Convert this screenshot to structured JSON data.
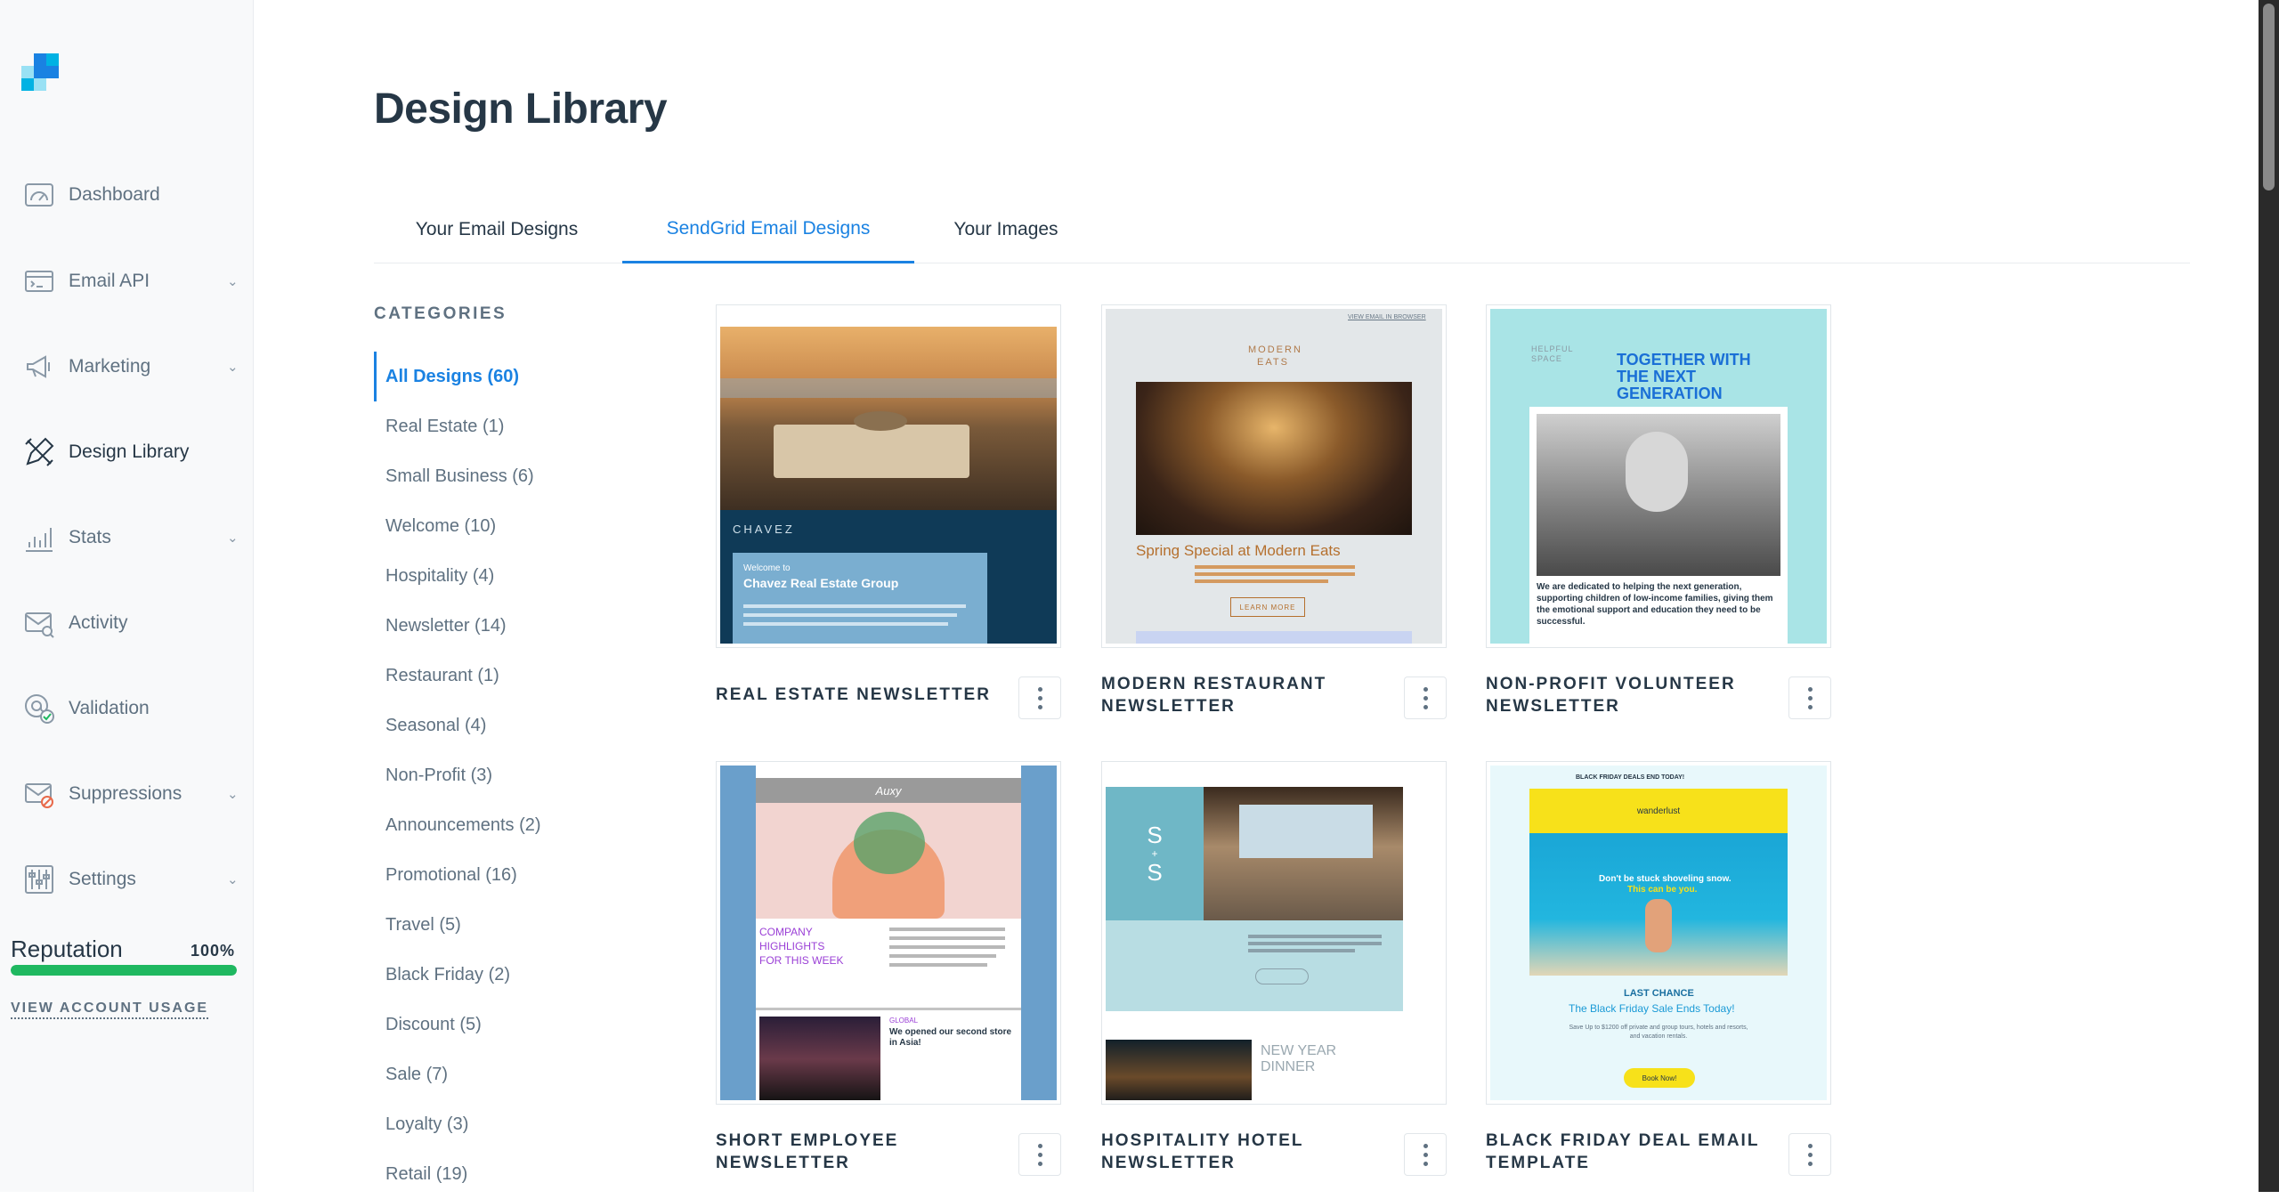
{
  "sidebar": {
    "items": [
      {
        "label": "Dashboard",
        "icon": "dashboard-gauge-icon",
        "has_chevron": false
      },
      {
        "label": "Email API",
        "icon": "email-api-icon",
        "has_chevron": true
      },
      {
        "label": "Marketing",
        "icon": "megaphone-icon",
        "has_chevron": true
      },
      {
        "label": "Design Library",
        "icon": "design-tools-icon",
        "has_chevron": false,
        "active": true
      },
      {
        "label": "Stats",
        "icon": "bar-chart-icon",
        "has_chevron": true
      },
      {
        "label": "Activity",
        "icon": "envelope-search-icon",
        "has_chevron": false
      },
      {
        "label": "Validation",
        "icon": "at-check-icon",
        "has_chevron": false
      },
      {
        "label": "Suppressions",
        "icon": "envelope-block-icon",
        "has_chevron": true
      },
      {
        "label": "Settings",
        "icon": "sliders-icon",
        "has_chevron": true
      }
    ],
    "reputation": {
      "label": "Reputation",
      "percent_text": "100%",
      "value": 1.0
    },
    "account_link": "VIEW ACCOUNT USAGE"
  },
  "header": {
    "title": "Design Library"
  },
  "tabs": [
    {
      "label": "Your Email Designs",
      "active": false
    },
    {
      "label": "SendGrid Email Designs",
      "active": true
    },
    {
      "label": "Your Images",
      "active": false
    }
  ],
  "categories": {
    "heading": "CATEGORIES",
    "items": [
      {
        "label": "All Designs (60)",
        "active": true
      },
      {
        "label": "Real Estate (1)"
      },
      {
        "label": "Small Business (6)"
      },
      {
        "label": "Welcome (10)"
      },
      {
        "label": "Hospitality (4)"
      },
      {
        "label": "Newsletter (14)"
      },
      {
        "label": "Restaurant (1)"
      },
      {
        "label": "Seasonal (4)"
      },
      {
        "label": "Non-Profit (3)"
      },
      {
        "label": "Announcements (2)"
      },
      {
        "label": "Promotional (16)"
      },
      {
        "label": "Travel (5)"
      },
      {
        "label": "Black Friday (2)"
      },
      {
        "label": "Discount (5)"
      },
      {
        "label": "Sale (7)"
      },
      {
        "label": "Loyalty (3)"
      },
      {
        "label": "Retail (19)"
      }
    ]
  },
  "designs": [
    {
      "title": "REAL ESTATE NEWSLETTER",
      "thumb": {
        "brand": "CHAVEZ",
        "welcome": "Welcome to",
        "headline": "Chavez Real Estate Group"
      }
    },
    {
      "title": "MODERN RESTAURANT NEWSLETTER",
      "thumb": {
        "brand_line1": "MODERN",
        "brand_line2": "EATS",
        "top_link": "VIEW EMAIL IN BROWSER",
        "headline": "Spring Special at Modern Eats",
        "button": "LEARN MORE"
      }
    },
    {
      "title": "NON-PROFIT VOLUNTEER NEWSLETTER",
      "thumb": {
        "brand_line1": "HELPFUL",
        "brand_line2": "SPACE",
        "headline_line1": "TOGETHER WITH",
        "headline_line2": "THE NEXT",
        "headline_line3": "GENERATION",
        "body": "We are dedicated to helping the next generation, supporting children of low-income families, giving them the emotional support and education they need to be successful."
      }
    },
    {
      "title": "SHORT EMPLOYEE NEWSLETTER",
      "thumb": {
        "brand": "Auxy",
        "headline_line1": "COMPANY",
        "headline_line2": "HIGHLIGHTS",
        "headline_line3": "FOR THIS WEEK",
        "tag": "GLOBAL",
        "story": "We opened our second store in Asia!"
      }
    },
    {
      "title": "HOSPITALITY HOTEL NEWSLETTER",
      "thumb": {
        "logo_line1": "S",
        "logo_line2": "+",
        "logo_line3": "S",
        "headline_line1": "NEW YEAR",
        "headline_line2": "DINNER"
      }
    },
    {
      "title": "BLACK FRIDAY DEAL EMAIL TEMPLATE",
      "thumb": {
        "top_bar": "BLACK FRIDAY DEALS END TODAY!",
        "brand": "wanderlust",
        "tagline_line1": "Don't be stuck shoveling snow.",
        "tagline_line2": "This can be you.",
        "kicker": "LAST CHANCE",
        "headline": "The Black Friday Sale Ends Today!",
        "body": "Save Up to $1200 off private and group tours, hotels and resorts, and vacation rentals.",
        "button": "Book Now!"
      }
    }
  ],
  "colors": {
    "accent": "#1a82e2",
    "reputation_green": "#1fb860",
    "text_dark": "#263746",
    "text_muted": "#5f7181"
  }
}
